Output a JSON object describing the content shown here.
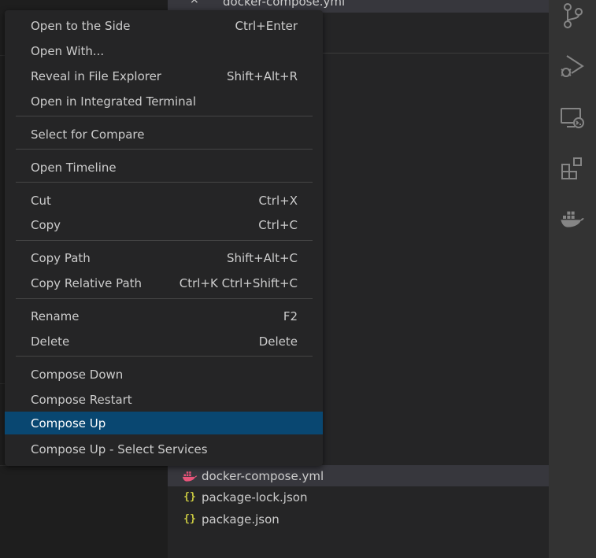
{
  "explorer": {
    "open_editor": {
      "close": "×",
      "name": "docker-compose.yml"
    },
    "peek_text": "o",
    "files": [
      {
        "name": "docker-compose.yml",
        "icon": "docker-icon",
        "selected": true
      },
      {
        "name": "package-lock.json",
        "icon": "json-icon",
        "selected": false
      },
      {
        "name": "package.json",
        "icon": "json-icon",
        "selected": false
      }
    ],
    "json_glyph": "{}"
  },
  "activity_bar": [
    "source-control-icon",
    "run-debug-icon",
    "remote-explorer-icon",
    "extensions-icon",
    "docker-icon"
  ],
  "context_menu": {
    "items": [
      {
        "label": "Open to the Side",
        "shortcut": "Ctrl+Enter"
      },
      {
        "label": "Open With...",
        "shortcut": ""
      },
      {
        "label": "Reveal in File Explorer",
        "shortcut": "Shift+Alt+R"
      },
      {
        "label": "Open in Integrated Terminal",
        "shortcut": ""
      },
      {
        "label": "Select for Compare",
        "shortcut": ""
      },
      {
        "label": "Open Timeline",
        "shortcut": ""
      },
      {
        "label": "Cut",
        "shortcut": "Ctrl+X"
      },
      {
        "label": "Copy",
        "shortcut": "Ctrl+C"
      },
      {
        "label": "Copy Path",
        "shortcut": "Shift+Alt+C"
      },
      {
        "label": "Copy Relative Path",
        "shortcut": "Ctrl+K Ctrl+Shift+C"
      },
      {
        "label": "Rename",
        "shortcut": "F2"
      },
      {
        "label": "Delete",
        "shortcut": "Delete"
      },
      {
        "label": "Compose Down",
        "shortcut": ""
      },
      {
        "label": "Compose Restart",
        "shortcut": ""
      },
      {
        "label": "Compose Up",
        "shortcut": "",
        "active": true
      },
      {
        "label": "Compose Up - Select Services",
        "shortcut": ""
      }
    ]
  },
  "colors": {
    "menu_bg": "#252526",
    "highlight": "#094771",
    "docker_pink": "#e8547a",
    "json_yellow": "#cbcb41"
  }
}
